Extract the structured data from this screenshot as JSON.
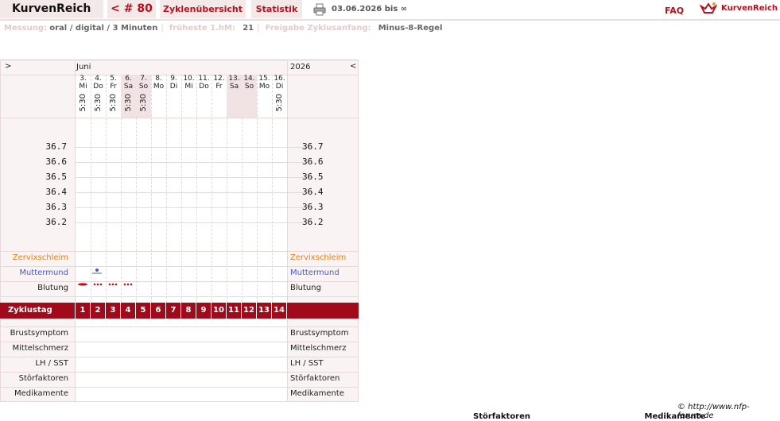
{
  "header": {
    "app_name": "KurvenReich",
    "cycle": "< # 80",
    "tabs": [
      "Zyklenübersicht",
      "Statistik"
    ],
    "date_range": "03.06.2026 bis ∞",
    "faq": "FAQ",
    "brand": "KurvenReich"
  },
  "info": {
    "messung_label": "Messung:",
    "messung_value": "oral / digital / 3 Minuten",
    "hm_label": "früheste 1.hM:",
    "hm_value": "21",
    "freigabe_label": "Freigabe Zyklusanfang:",
    "freigabe_value": "Minus-8-Regel"
  },
  "chart": {
    "nav_prev": ">",
    "nav_next": "<",
    "month": "Juni",
    "year": "2026",
    "days": [
      {
        "date": "3.",
        "weekday": "Mi",
        "time": "5:30",
        "shaded": false
      },
      {
        "date": "4.",
        "weekday": "Do",
        "time": "5:30",
        "shaded": false
      },
      {
        "date": "5.",
        "weekday": "Fr",
        "time": "5:30",
        "shaded": false
      },
      {
        "date": "6.",
        "weekday": "Sa",
        "time": "5:30",
        "shaded": true
      },
      {
        "date": "7.",
        "weekday": "So",
        "time": "5:30",
        "shaded": true
      },
      {
        "date": "8.",
        "weekday": "Mo",
        "time": "",
        "shaded": false
      },
      {
        "date": "9.",
        "weekday": "Di",
        "time": "",
        "shaded": false
      },
      {
        "date": "10.",
        "weekday": "Mi",
        "time": "",
        "shaded": false
      },
      {
        "date": "11.",
        "weekday": "Do",
        "time": "",
        "shaded": false
      },
      {
        "date": "12.",
        "weekday": "Fr",
        "time": "",
        "shaded": false
      },
      {
        "date": "13.",
        "weekday": "Sa",
        "time": "",
        "shaded": true
      },
      {
        "date": "14.",
        "weekday": "So",
        "time": "",
        "shaded": true
      },
      {
        "date": "15.",
        "weekday": "Mo",
        "time": "",
        "shaded": false
      },
      {
        "date": "16.",
        "weekday": "Di",
        "time": "5:30",
        "shaded": false
      }
    ],
    "temps": [
      "36.7",
      "36.6",
      "36.5",
      "36.4",
      "36.3",
      "36.2"
    ],
    "rows": {
      "zervix": "Zervixschleim",
      "muttermund": "Muttermund",
      "blutung": "Blutung",
      "zyklustag": "Zyklustag",
      "brust": "Brustsymptom",
      "mittel": "Mittelschmerz",
      "lh": "LH / SST",
      "stoer": "Störfaktoren",
      "medi": "Medikamente"
    },
    "cycle_days": [
      "1",
      "2",
      "3",
      "4",
      "5",
      "6",
      "7",
      "8",
      "9",
      "10",
      "11",
      "12",
      "13",
      "14"
    ]
  },
  "colors": {
    "accent": "#b8101c",
    "zervix": "#e8801a",
    "muttermund": "#4a5cc0",
    "bar": "#a10a1a"
  },
  "footer": {
    "copyright": "© http://www.nfp-forum.de"
  }
}
